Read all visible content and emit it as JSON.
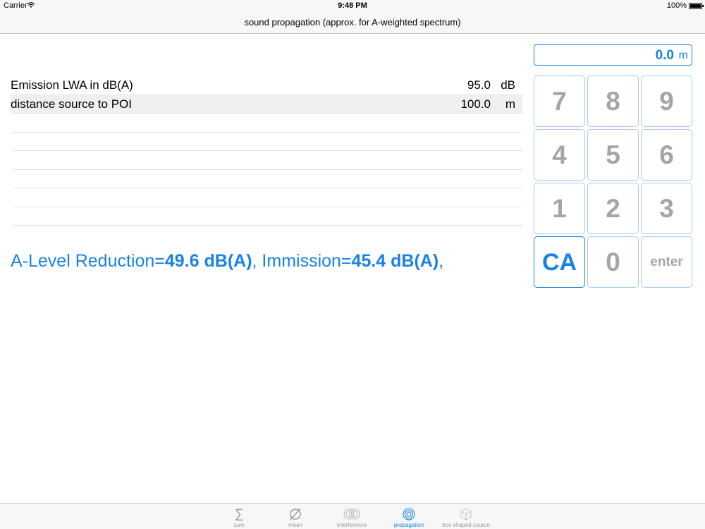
{
  "status_bar": {
    "carrier": "Carrier",
    "wifi_icon": "wifi-icon",
    "time": "9:48 PM",
    "battery": "100%"
  },
  "nav": {
    "title": "sound propagation (approx. for A-weighted spectrum)"
  },
  "rows": [
    {
      "label": "Emission LWA in dB(A)",
      "value": "95.0",
      "unit": "dB"
    },
    {
      "label": "distance source to POI",
      "value": "100.0",
      "unit": "m"
    }
  ],
  "result": {
    "reduction_prefix": "A-Level Reduction=",
    "reduction_value": "49.6 dB(A)",
    "separator": ", Immission=",
    "immission_value": "45.4 dB(A)",
    "suffix": ","
  },
  "display": {
    "value": "0.0",
    "unit": "m"
  },
  "keypad": {
    "keys": [
      "7",
      "8",
      "9",
      "4",
      "5",
      "6",
      "1",
      "2",
      "3",
      "CA",
      "0",
      "enter"
    ]
  },
  "tabs": [
    {
      "label": "sum",
      "icon": "sigma-icon"
    },
    {
      "label": "mean",
      "icon": "mean-icon"
    },
    {
      "label": "interference",
      "icon": "interference-icon"
    },
    {
      "label": "propagation",
      "icon": "propagation-icon",
      "active": true
    },
    {
      "label": "box shaped source",
      "icon": "box-icon"
    }
  ],
  "colors": {
    "accent": "#1a82e6",
    "key_border": "#a9c8f0",
    "key_text": "#a5a5a5",
    "bar_bg": "#f7f7f7"
  }
}
